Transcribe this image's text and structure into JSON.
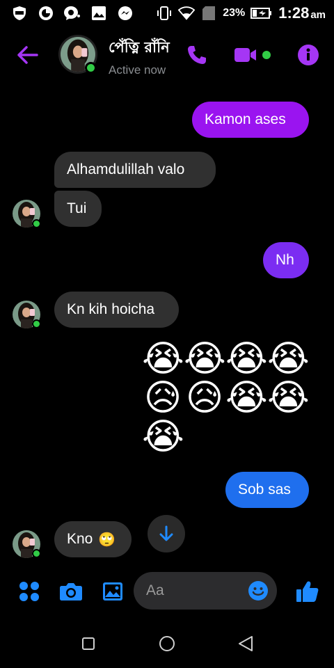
{
  "status_bar": {
    "battery_percent": "23%",
    "time": "1:28",
    "ampm": "am"
  },
  "header": {
    "contact_name": "পেঁত্নি রাঁনি",
    "status": "Active now"
  },
  "colors": {
    "accent_purple": "#9a14f0",
    "accent_blue": "#1f6fee",
    "online_green": "#31cc46"
  },
  "messages": {
    "m1": "Kamon ases",
    "m2": "Alhamdulillah valo",
    "m3": "Tui",
    "m4": "Nh",
    "m5": "Kn kih hoicha",
    "emojis": [
      "😭",
      "😭",
      "😭",
      "😭",
      "😥",
      "😥",
      "😭",
      "😭",
      "😭"
    ],
    "m6": "Sob sas",
    "m7_text": "Kno",
    "m7_emoji": "🙄"
  },
  "composer": {
    "placeholder": "Aa"
  },
  "icons": [
    "back-arrow-icon",
    "phone-icon",
    "video-icon",
    "info-icon",
    "apps-icon",
    "camera-icon",
    "gallery-icon",
    "emoji-icon",
    "thumbs-up-icon",
    "arrow-down-icon"
  ]
}
